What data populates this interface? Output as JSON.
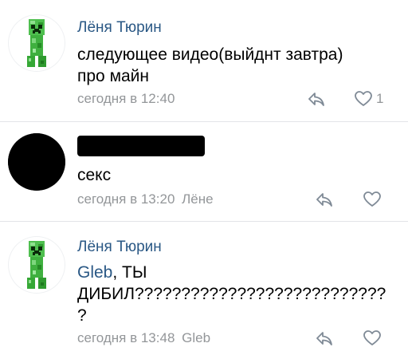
{
  "comments": [
    {
      "author": "Лёня Тюрин",
      "text_lines": [
        "следующее видео(выйднт завтра)",
        "про майн"
      ],
      "time": "сегодня в 12:40",
      "reply_to": "",
      "likes": "1",
      "avatar": "creeper-avatar"
    },
    {
      "author": "",
      "text_lines": [
        "секс"
      ],
      "time": "сегодня в 13:20",
      "reply_to": "Лёне",
      "likes": "",
      "avatar": "black-avatar"
    },
    {
      "author": "Лёня Тюрин",
      "mention": "Gleb",
      "text_after_mention": ", ТЫ",
      "text_lines": [
        "ДИБИЛ???????????????????????????",
        "?"
      ],
      "time": "сегодня в 13:48",
      "reply_to": "Gleb",
      "likes": "",
      "avatar": "creeper-avatar"
    }
  ],
  "icons": {
    "reply": "reply-arrow-icon",
    "like": "heart-icon"
  },
  "colors": {
    "link": "#2a5885",
    "meta": "#939699",
    "divider": "#e3e4e8",
    "creeper_light": "#5fc95f",
    "creeper_dark": "#1f7a1f"
  }
}
